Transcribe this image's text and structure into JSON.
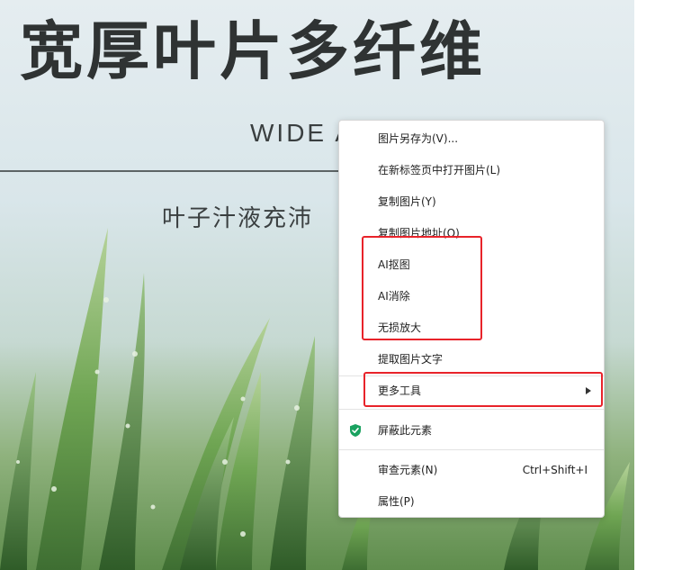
{
  "banner": {
    "headline": "宽厚叶片多纤维",
    "subtitle_en": "WIDE A",
    "tagline": "叶子汁液充沛"
  },
  "context_menu": {
    "items": [
      {
        "label": "图片另存为(V)..."
      },
      {
        "label": "在新标签页中打开图片(L)"
      },
      {
        "label": "复制图片(Y)"
      },
      {
        "label": "复制图片地址(O)"
      },
      {
        "label": "AI抠图"
      },
      {
        "label": "AI消除"
      },
      {
        "label": "无损放大"
      },
      {
        "label": "提取图片文字"
      },
      {
        "label": "更多工具"
      },
      {
        "label": "屏蔽此元素"
      },
      {
        "label": "审查元素(N)",
        "shortcut": "Ctrl+Shift+I"
      },
      {
        "label": "属性(P)"
      }
    ]
  },
  "colors": {
    "highlight_border": "#e8232a",
    "shield_icon": "#1aa260"
  },
  "icons": {
    "submenu_arrow": "triangle-right-icon",
    "block_element": "shield-icon"
  }
}
